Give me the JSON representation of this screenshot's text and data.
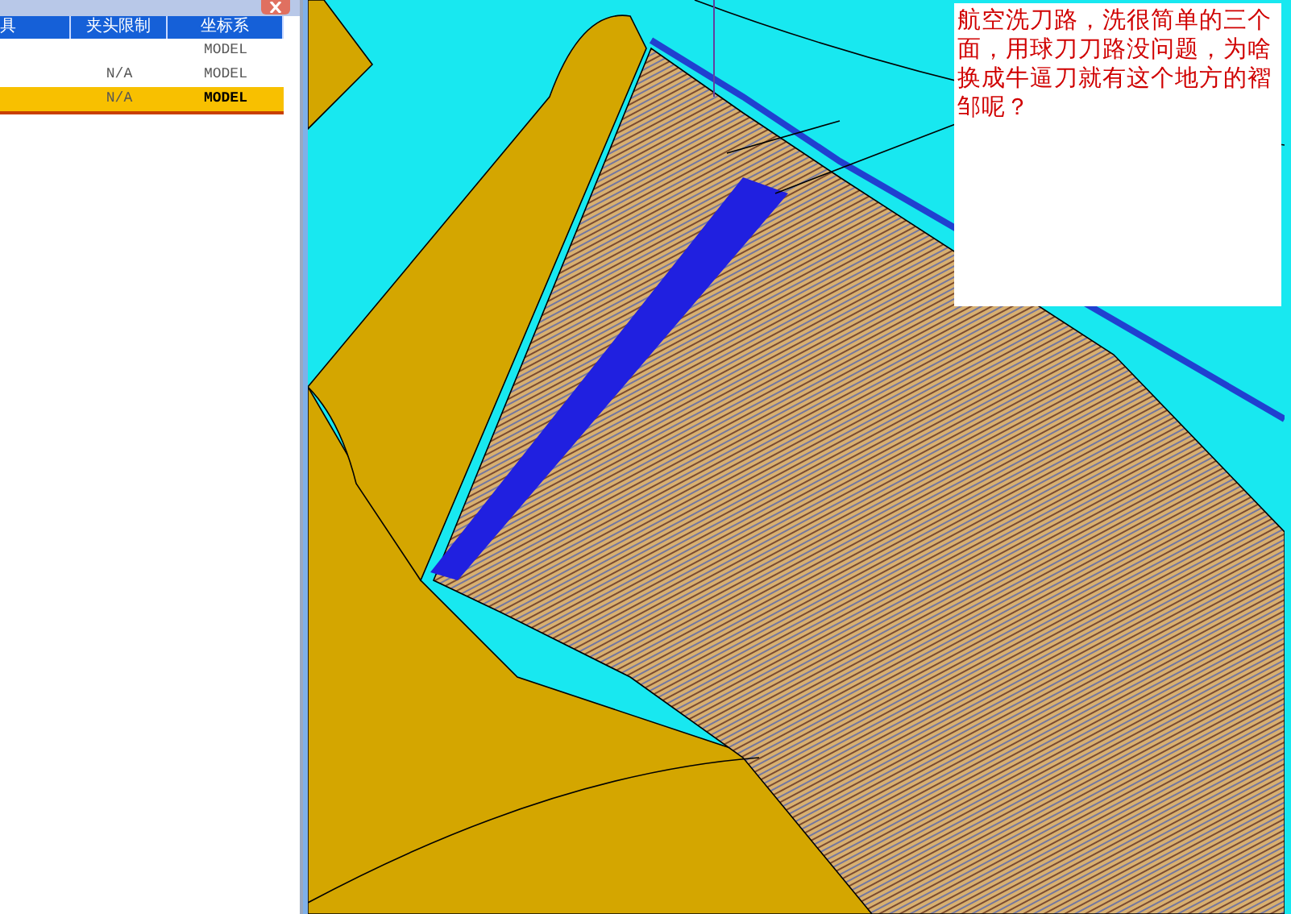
{
  "panel": {
    "columns": [
      "具",
      "夹头限制",
      "坐标系"
    ],
    "rows": [
      {
        "selected": false,
        "coordinate_system": "MODEL"
      },
      {
        "selected": false,
        "clamp_limit": "N/A",
        "coordinate_system": "MODEL"
      },
      {
        "selected": true,
        "clamp_limit": "N/A",
        "coordinate_system": "MODEL"
      }
    ]
  },
  "annotation": {
    "text": "航空洗刀路，洗很简单的三个面，用球刀刀路没问题，为啥换成牛逼刀就有这个地方的褶邹呢？"
  }
}
